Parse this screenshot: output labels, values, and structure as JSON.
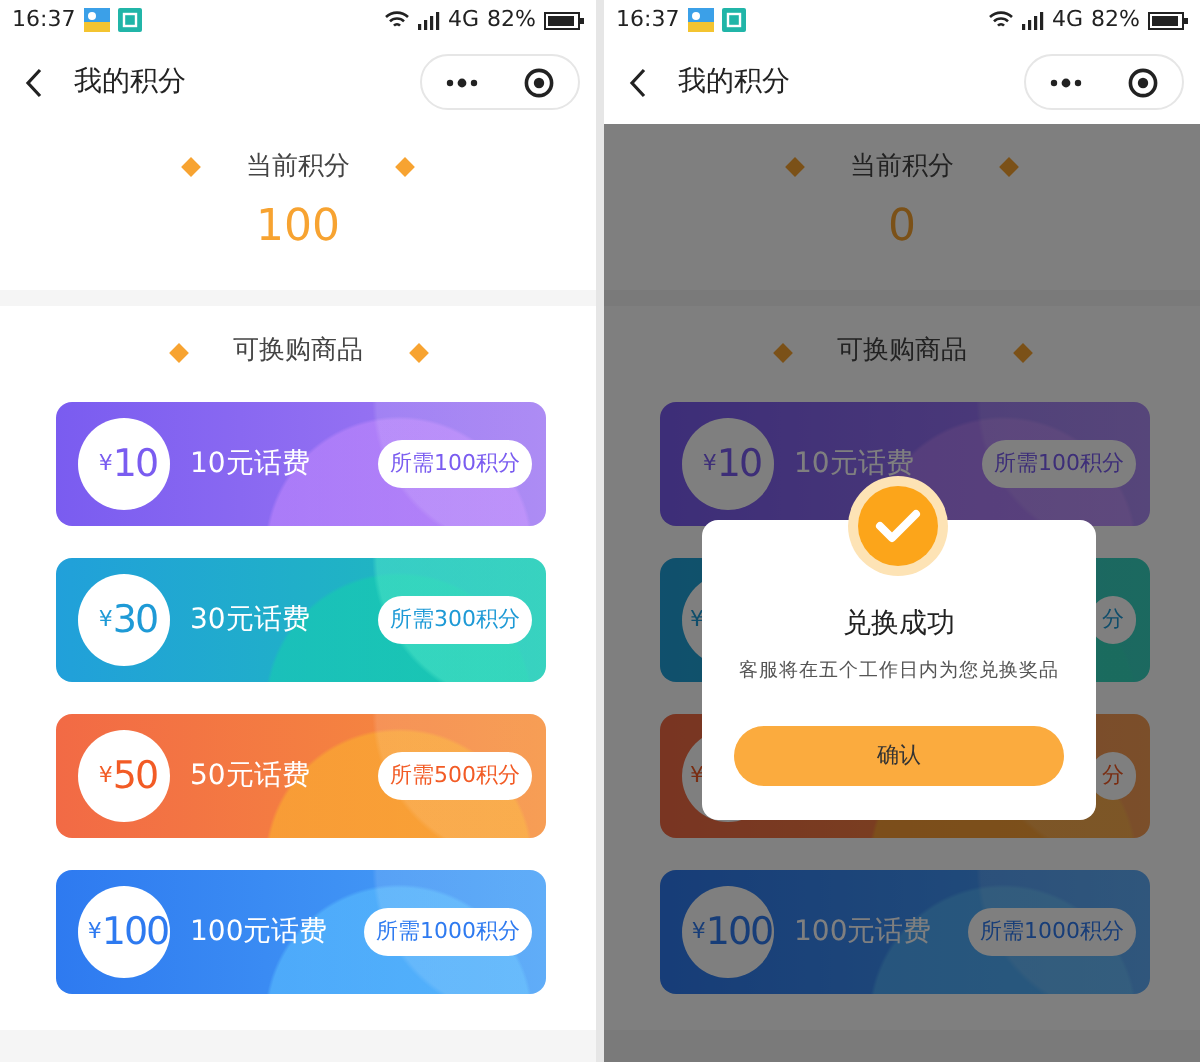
{
  "screens": [
    {
      "status_bar": {
        "time": "16:37",
        "network": "4G",
        "battery": "82%"
      },
      "nav": {
        "title": "我的积分"
      },
      "points": {
        "label": "当前积分",
        "value": "100"
      },
      "section_title": "可换购商品",
      "cards": [
        {
          "color": "#7a5cf0",
          "currency": "¥",
          "amount": "10",
          "name": "10元话费",
          "cost": "所需100积分"
        },
        {
          "color": "#1e9ad6",
          "currency": "¥",
          "amount": "30",
          "name": "30元话费",
          "cost": "所需300积分"
        },
        {
          "color": "#f25b25",
          "currency": "¥",
          "amount": "50",
          "name": "50元话费",
          "cost": "所需500积分"
        },
        {
          "color": "#2e7af0",
          "currency": "¥",
          "amount": "100",
          "name": "100元话费",
          "cost": "所需1000积分"
        }
      ]
    },
    {
      "status_bar": {
        "time": "16:37",
        "network": "4G",
        "battery": "82%"
      },
      "nav": {
        "title": "我的积分"
      },
      "points": {
        "label": "当前积分",
        "value": "0"
      },
      "section_title": "可换购商品",
      "cards": [
        {
          "color": "#3d2e78",
          "currency": "¥",
          "amount": "10",
          "name": "10元话费",
          "cost": "所需100积分"
        },
        {
          "color": "#0f4d6b",
          "currency": "¥",
          "cost": "分"
        },
        {
          "color": "#792d12",
          "currency": "¥",
          "cost": "分"
        },
        {
          "color": "#173d78",
          "currency": "¥",
          "amount": "100",
          "name": "100元话费",
          "cost": "所需1000积分"
        }
      ],
      "dialog": {
        "title": "兑换成功",
        "message": "客服将在五个工作日内为您兑换奖品",
        "button": "确认"
      }
    }
  ]
}
